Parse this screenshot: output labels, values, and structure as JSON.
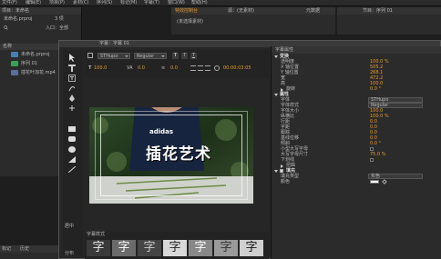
{
  "menubar": {
    "items": [
      "文件(F)",
      "编辑(E)",
      "项目(P)",
      "素材(C)",
      "序列(S)",
      "标记(M)",
      "字幕(T)",
      "窗口(W)",
      "帮助(H)"
    ]
  },
  "project_panel": {
    "tab": "项目：未命名",
    "project_file": "未命名.prproj",
    "item_count": "3 项",
    "filter_label": "入口：全部",
    "column_name": "名称",
    "items": [
      {
        "name": "未命名.prproj"
      },
      {
        "name": "序列 01"
      },
      {
        "name": "插花叶加花.mp4"
      }
    ]
  },
  "source_monitor": {
    "tabs": [
      "特效控制台",
      "源：(无素材)",
      "元数据"
    ],
    "placeholder": "(未选择素材)"
  },
  "program_monitor": {
    "tab": "节目：序列 01"
  },
  "title_designer": {
    "title": "字幕：字幕 01",
    "font_family": "STHupo",
    "font_style": "Regular",
    "font_size": "100.0",
    "kerning": "0.0",
    "leading": "0.0",
    "timecode": "00:00:03:05",
    "video_text": "adidas",
    "overlay_text": "插花艺术"
  },
  "title_styles": {
    "header": "字幕样式",
    "swatches": [
      "字",
      "字",
      "字",
      "字",
      "字",
      "字",
      "字"
    ]
  },
  "properties_panel": {
    "header": "字幕属性",
    "transform_section": "变换",
    "transform": [
      {
        "label": "透明度",
        "value": "100.0 %"
      },
      {
        "label": "X 轴位置",
        "value": "505.2"
      },
      {
        "label": "Y 轴位置",
        "value": "268.1"
      },
      {
        "label": "宽",
        "value": "472.2"
      },
      {
        "label": "高",
        "value": "100.0"
      }
    ],
    "rotation_label": "旋转",
    "rotation_value": "0.0 °",
    "attributes_section": "属性",
    "attributes": [
      {
        "label": "字体",
        "value": "STHupo"
      },
      {
        "label": "字体样式",
        "value": "Regular"
      },
      {
        "label": "字体大小",
        "value": "100.0"
      },
      {
        "label": "纵横比",
        "value": "100.0 %"
      },
      {
        "label": "行距",
        "value": "0.0"
      },
      {
        "label": "字距",
        "value": "0.0"
      },
      {
        "label": "跟踪",
        "value": "0.0"
      },
      {
        "label": "基线位移",
        "value": "0.0"
      },
      {
        "label": "倾斜",
        "value": "0.0 °"
      },
      {
        "label": "小型大写字母",
        "value": ""
      },
      {
        "label": "大写字母尺寸",
        "value": "75.0 %"
      },
      {
        "label": "下划线",
        "value": ""
      }
    ],
    "distort_label": "扭曲",
    "fill_section": "填充",
    "fill_type_label": "填充类型",
    "fill_type_value": "实色",
    "color_label": "颜色"
  },
  "bottom_panels": {
    "tabs": [
      "标记",
      "历史"
    ]
  },
  "tool_panel": {
    "labels": [
      "居中",
      "分布"
    ]
  },
  "colors": {
    "accent": "#e89a2e",
    "panel_bg": "#2b2b2b",
    "app_bg": "#1e1e1e",
    "safe_area": "#ffffff",
    "title_text_fill": "#ffffff"
  }
}
